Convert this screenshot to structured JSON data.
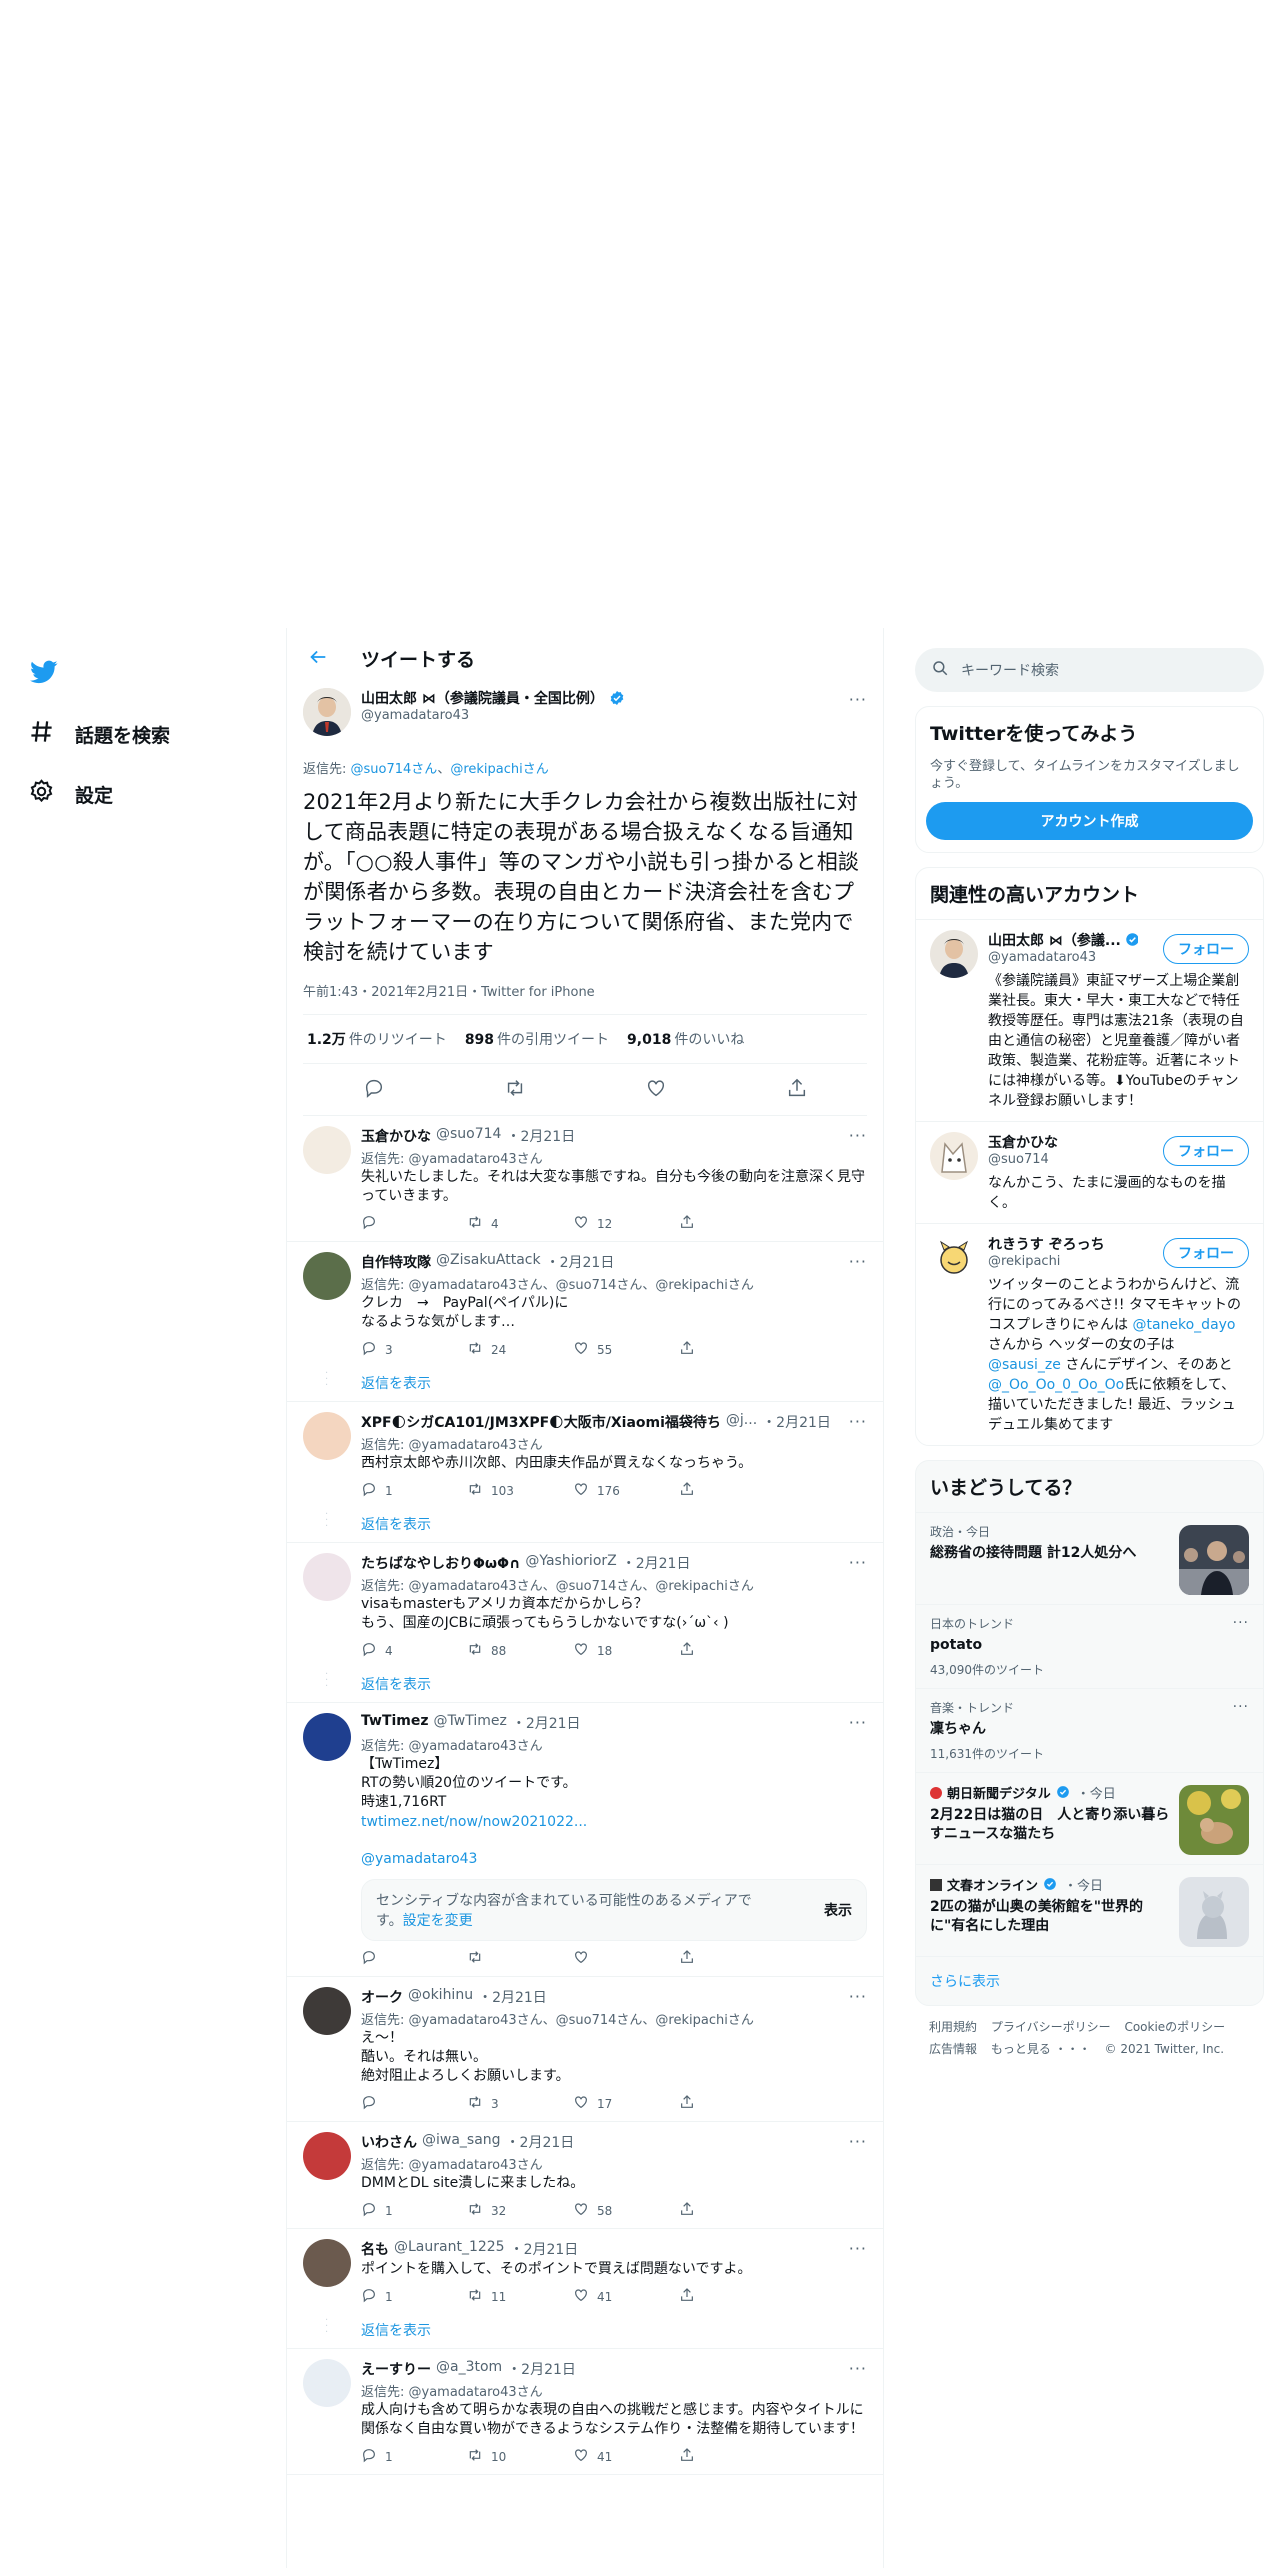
{
  "nav": {
    "explore": "話題を検索",
    "settings": "設定"
  },
  "header": {
    "title": "ツイートする"
  },
  "focus": {
    "name": "山田太郎 ⋈（参議院議員・全国比例）",
    "handle": "@yamadataro43",
    "replying_prefix": "返信先:",
    "replying_to": [
      "@suo714さん",
      "@rekipachiさん"
    ],
    "text": "2021年2月より新たに大手クレカ会社から複数出版社に対して商品表題に特定の表現がある場合扱えなくなる旨通知が。「○○殺人事件」等のマンガや小説も引っ掛かると相談が関係者から多数。表現の自由とカード決済会社を含むプラットフォーマーの在り方について関係府省、また党内で検討を続けています",
    "meta": "午前1:43・2021年2月21日・Twitter for iPhone",
    "retweets": "1.2万",
    "retweets_label": "件のリツイート",
    "quotes": "898",
    "quotes_label": "件の引用ツイート",
    "likes": "9,018",
    "likes_label": "件のいいね"
  },
  "replies": [
    {
      "name": "玉倉かひな",
      "handle": "@suo714",
      "date": "・2月21日",
      "reply": "返信先: @yamadataro43さん",
      "text": "失礼いたしました。それは大変な事態ですね。自分も今後の動向を注意深く見守っていきます。",
      "rt": "4",
      "like": "12"
    },
    {
      "name": "自作特攻隊",
      "handle": "@ZisakuAttack",
      "date": "・2月21日",
      "reply": "返信先: @yamadataro43さん、@suo714さん、@rekipachiさん",
      "text": "クレカ　→　PayPal(ペイパル)に\nなるような気がします…",
      "reply_count": "3",
      "rt": "24",
      "like": "55",
      "show": "返信を表示"
    },
    {
      "name": "XPF🌓シガCA101/JM3XPF🌓大阪市/Xiaomi福袋待ち",
      "handle": "@j...",
      "date": "・2月21日",
      "reply": "返信先: @yamadataro43さん",
      "text": "西村京太郎や赤川次郎、内田康夫作品が買えなくなっちゃう。",
      "reply_count": "1",
      "rt": "103",
      "like": "176",
      "show": "返信を表示"
    },
    {
      "name": "たちばなやしおりΦωΦ∩",
      "handle": "@YashioriorZ",
      "date": "・2月21日",
      "reply": "返信先: @yamadataro43さん、@suo714さん、@rekipachiさん",
      "text": "visaもmasterもアメリカ資本だからかしら？\nもう、国産のJCBに頑張ってもらうしかないですな(›´ω`‹ )",
      "reply_count": "4",
      "rt": "88",
      "like": "18",
      "show": "返信を表示"
    },
    {
      "name": "TwTimez",
      "handle": "@TwTimez",
      "date": "・2月21日",
      "reply": "返信先: @yamadataro43さん",
      "text": "【TwTimez】\nRTの勢い順20位のツイートです。\n時速1,716RT",
      "link": "twtimez.net/now/now2021022...",
      "mention": "@yamadataro43",
      "sensitive": "センシティブな内容が含まれている可能性のあるメディアです。",
      "sensitive_link": "設定を変更",
      "sensitive_show": "表示"
    },
    {
      "name": "オーク",
      "handle": "@okihinu",
      "date": "・2月21日",
      "reply": "返信先: @yamadataro43さん、@suo714さん、@rekipachiさん",
      "text": "え〜！\n酷い。それは無い。\n絶対阻止よろしくお願いします。",
      "rt": "3",
      "like": "17"
    },
    {
      "name": "いわさん",
      "handle": "@iwa_sang",
      "date": "・2月21日",
      "reply": "返信先: @yamadataro43さん",
      "text": "DMMとDL site潰しに来ましたね。",
      "reply_count": "1",
      "rt": "32",
      "like": "58"
    },
    {
      "name": "名も",
      "handle": "@Laurant_1225",
      "date": "・2月21日",
      "text": "ポイントを購入して、そのポイントで買えば問題ないですよ。",
      "reply_count": "1",
      "rt": "11",
      "like": "41",
      "show": "返信を表示"
    },
    {
      "name": "えーすりー",
      "handle": "@a_3tom",
      "date": "・2月21日",
      "reply": "返信先: @yamadataro43さん",
      "text": "成人向けも含めて明らかな表現の自由への挑戦だと感じます。内容やタイトルに関係なく自由な買い物ができるようなシステム作り・法整備を期待しています！",
      "reply_count": "1",
      "rt": "10",
      "like": "41"
    }
  ],
  "right": {
    "search_placeholder": "キーワード検索",
    "signup_title": "Twitterを使ってみよう",
    "signup_sub": "今すぐ登録して、タイムラインをカスタマイズしましょう。",
    "signup_button": "アカウント作成",
    "related_title": "関連性の高いアカウント",
    "follow_label": "フォロー",
    "accounts": [
      {
        "name": "山田太郎 ⋈（参議...",
        "handle": "@yamadataro43",
        "bio": "《参議院議員》東証マザーズ上場企業創業社長。東大・早大・東工大などで特任教授等歴任。専門は憲法21条（表現の自由と通信の秘密）と児童養護／障がい者政策、製造業、花粉症等。近著にネットには神様がいる等。⬇YouTubeのチャンネル登録お願いします！"
      },
      {
        "name": "玉倉かひな",
        "handle": "@suo714",
        "bio": "なんかこう、たまに漫画的なものを描く。"
      },
      {
        "name": "れきうす ぞろっち",
        "handle": "@rekipachi",
        "bio_1": "ツイッターのことようわからんけど、流行にのってみるべさ!! タマモキャットのコスプレきりにゃんは ",
        "bio_link1": "@taneko_dayo",
        "bio_2": " さんから ヘッダーの女の子は ",
        "bio_link2": "@sausi_ze",
        "bio_3": " さんにデザイン、そのあと",
        "bio_link3": "@_Oo_Oo_0_Oo_Oo",
        "bio_4": "氏に依頼をして、描いていただきました! 最近、ラッシュデュエル集めてます"
      }
    ],
    "trends_title": "いまどうしてる？",
    "trends": [
      {
        "cat": "政治・今日",
        "title": "総務省の接待問題 計12人処分へ"
      },
      {
        "cat": "日本のトレンド",
        "title": "potato",
        "count": "43,090件のツイート"
      },
      {
        "cat": "音楽・トレンド",
        "title": "凜ちゃん",
        "count": "11,631件のツイート"
      },
      {
        "source": "朝日新聞デジタル",
        "time": "・今日",
        "title": "2月22日は猫の日　人と寄り添い暮らすニュースな猫たち"
      },
      {
        "source": "文春オンライン",
        "time": "・今日",
        "title": "2匹の猫が山奥の美術館を\"世界的に\"有名にした理由"
      }
    ],
    "show_more": "さらに表示",
    "footer": [
      "利用規約",
      "プライバシーポリシー",
      "Cookieのポリシー",
      "広告情報",
      "もっと見る ・・・",
      "© 2021 Twitter, Inc."
    ]
  }
}
